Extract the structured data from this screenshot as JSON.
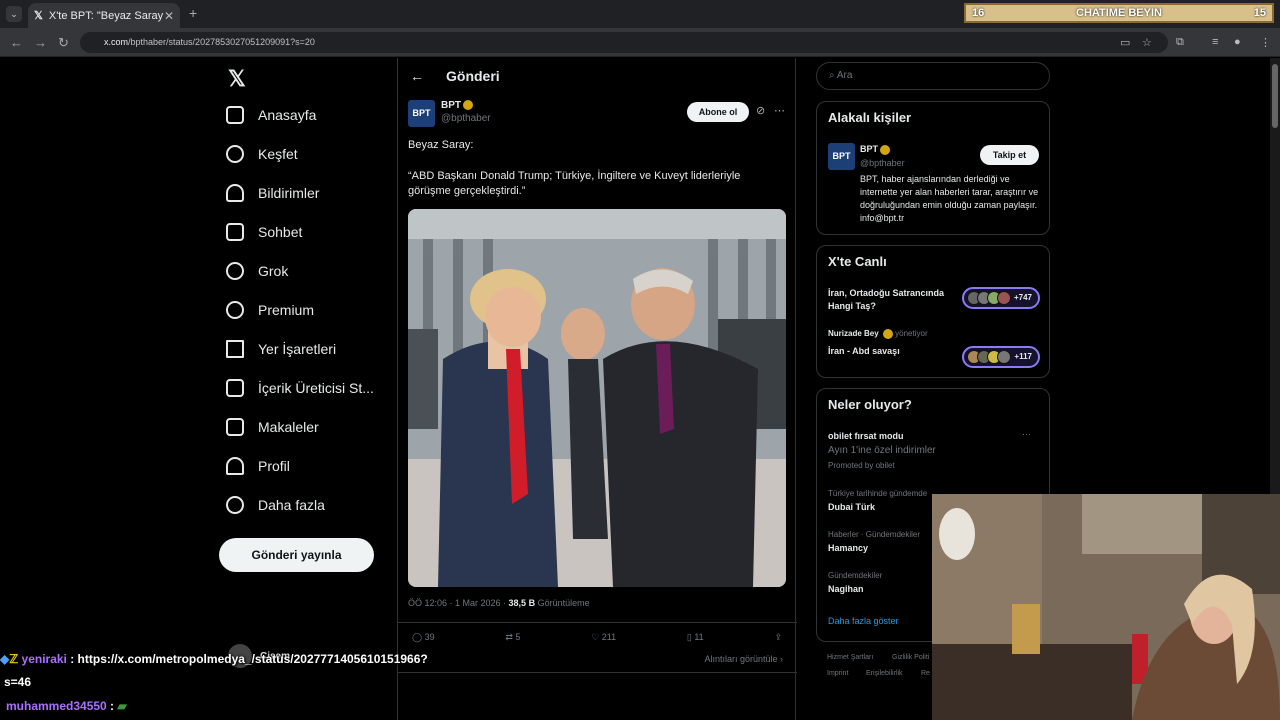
{
  "browser": {
    "tab_title": "X'te BPT: \"Beyaz Saray: \"ABD Ba",
    "url_prefix": "x.com",
    "url_rest": "/bpthaber/status/2027853027051209091?s=20"
  },
  "overlay_bar": {
    "left": "16",
    "title": "CHATIME BEYIN",
    "right": "15"
  },
  "sidebar": {
    "items": [
      {
        "label": "Anasayfa"
      },
      {
        "label": "Keşfet"
      },
      {
        "label": "Bildirimler"
      },
      {
        "label": "Sohbet"
      },
      {
        "label": "Grok"
      },
      {
        "label": "Premium"
      },
      {
        "label": "Yer İşaretleri"
      },
      {
        "label": "İçerik Üreticisi St..."
      },
      {
        "label": "Makaleler"
      },
      {
        "label": "Profil"
      },
      {
        "label": "Daha fazla"
      }
    ],
    "post_button": "Gönderi yayınla",
    "user_name": "Çisem"
  },
  "main": {
    "title": "Gönderi",
    "author_name": "BPT",
    "author_handle": "@bpthaber",
    "subscribe": "Abone ol",
    "text_line1": "Beyaz Saray:",
    "text_line2": "“ABD Başkanı Donald Trump; Türkiye, İngiltere ve Kuveyt liderleriyle görüşme gerçekleştirdi.”",
    "meta_time": "ÖÖ 12:06 · 1 Mar 2026 · ",
    "meta_views": "38,5 B",
    "meta_views_label": " Görüntüleme",
    "replies": "39",
    "reposts": "5",
    "likes": "211",
    "bookmarks": "11",
    "quotes_link": "Alıntıları görüntüle ›"
  },
  "right": {
    "search_placeholder": "Ara",
    "related_title": "Alakalı kişiler",
    "related_name": "BPT",
    "related_handle": "@bpthaber",
    "follow": "Takip et",
    "related_bio": "BPT, haber ajanslarından derlediği ve internette yer alan haberleri tarar, araştırır ve doğruluğundan emin olduğu zaman paylaşır. info@bpt.tr",
    "live_title": "X'te Canlı",
    "live1_title": "İran, Ortadoğu Satrancında Hangi Taş?",
    "live1_count": "+747",
    "live2_host": "Nurizade Bey",
    "live2_role": "yönetiyor",
    "live2_title": "İran - Abd savaşı",
    "live2_count": "+117",
    "trends_title": "Neler oluyor?",
    "trend_promo_name": "obilet fırsat modu",
    "trend_promo_desc": "Ayın 1'ine özel indirimler",
    "trend_promo_by": "Promoted by obilet",
    "trends": [
      {
        "ctx": "Türkiye tarihinde gündemde",
        "name": "Dubai Türk"
      },
      {
        "ctx": "Haberler · Gündemdekiler",
        "name": "Hamancy"
      },
      {
        "ctx": "Gündemdekiler",
        "name": "Nagihan"
      }
    ],
    "show_more": "Daha fazla göster",
    "footer1": "Hizmet Şartları",
    "footer2": "Gizlilik Politi",
    "footer3": "Imprint",
    "footer4": "Erişilebilirlik",
    "footer5": "Re"
  },
  "chat": {
    "msg1_user": "yeniraki",
    "msg1_text": " : https://x.com/metropolmedya_/status/2027771405610151966?",
    "msg1_cont": "s=46",
    "msg2_user": "muhammed34550",
    "msg2_text": " : "
  },
  "colors": {
    "accent_purple": "#a970ff",
    "x_blue": "#1d9bf0",
    "verified_gold": "#d4a514"
  }
}
